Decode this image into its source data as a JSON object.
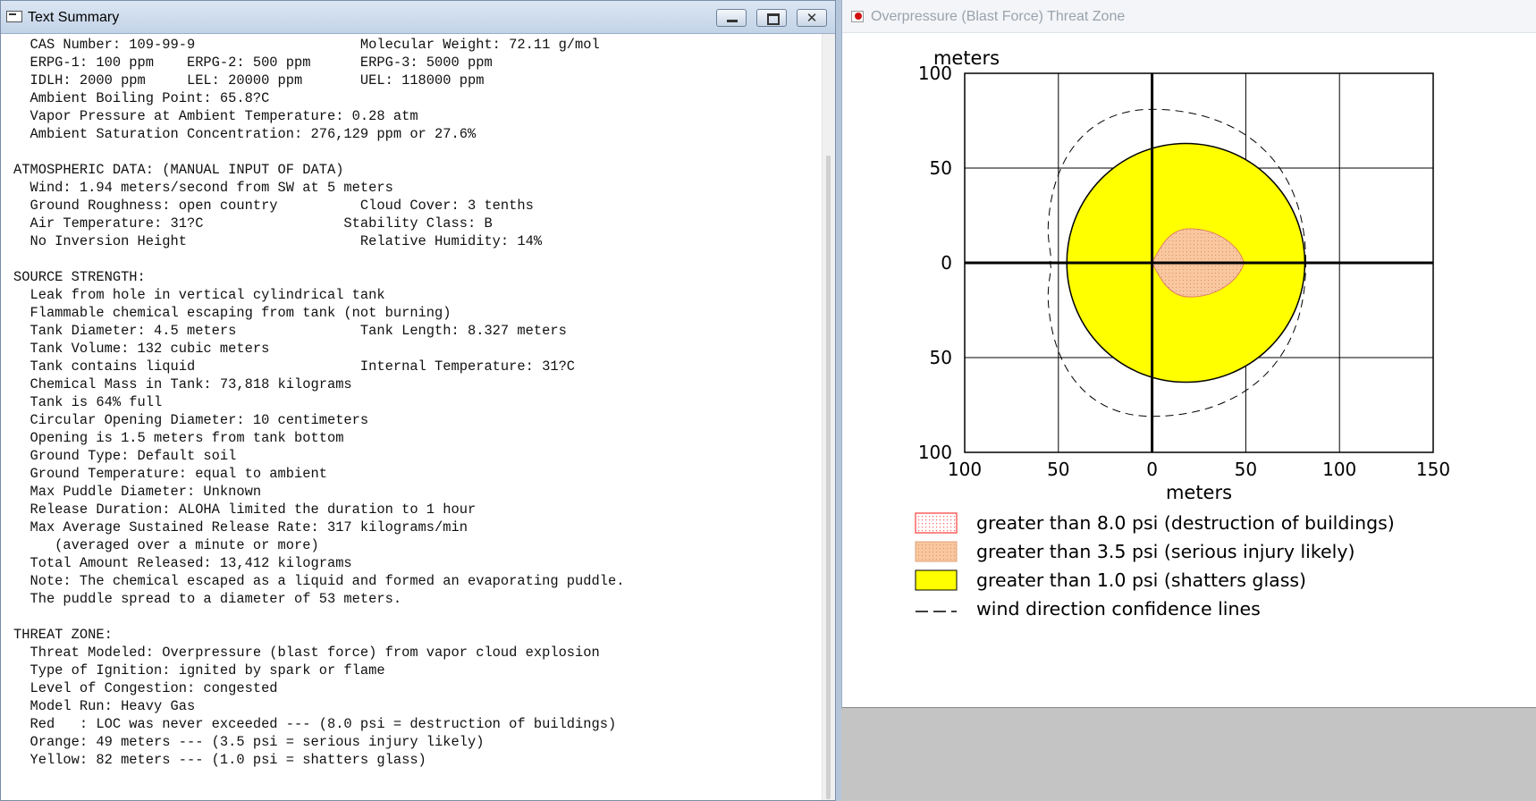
{
  "left_window": {
    "title": "Text Summary",
    "lines": [
      "  CAS Number: 109-99-9                    Molecular Weight: 72.11 g/mol",
      "  ERPG-1: 100 ppm    ERPG-2: 500 ppm      ERPG-3: 5000 ppm",
      "  IDLH: 2000 ppm     LEL: 20000 ppm       UEL: 118000 ppm",
      "  Ambient Boiling Point: 65.8?C",
      "  Vapor Pressure at Ambient Temperature: 0.28 atm",
      "  Ambient Saturation Concentration: 276,129 ppm or 27.6%",
      "",
      "ATMOSPHERIC DATA: (MANUAL INPUT OF DATA)",
      "  Wind: 1.94 meters/second from SW at 5 meters",
      "  Ground Roughness: open country          Cloud Cover: 3 tenths",
      "  Air Temperature: 31?C                 Stability Class: B",
      "  No Inversion Height                     Relative Humidity: 14%",
      "",
      "SOURCE STRENGTH:",
      "  Leak from hole in vertical cylindrical tank",
      "  Flammable chemical escaping from tank (not burning)",
      "  Tank Diameter: 4.5 meters               Tank Length: 8.327 meters",
      "  Tank Volume: 132 cubic meters",
      "  Tank contains liquid                    Internal Temperature: 31?C",
      "  Chemical Mass in Tank: 73,818 kilograms",
      "  Tank is 64% full",
      "  Circular Opening Diameter: 10 centimeters",
      "  Opening is 1.5 meters from tank bottom",
      "  Ground Type: Default soil",
      "  Ground Temperature: equal to ambient",
      "  Max Puddle Diameter: Unknown",
      "  Release Duration: ALOHA limited the duration to 1 hour",
      "  Max Average Sustained Release Rate: 317 kilograms/min",
      "     (averaged over a minute or more)",
      "  Total Amount Released: 13,412 kilograms",
      "  Note: The chemical escaped as a liquid and formed an evaporating puddle.",
      "  The puddle spread to a diameter of 53 meters.",
      "",
      "THREAT ZONE:",
      "  Threat Modeled: Overpressure (blast force) from vapor cloud explosion",
      "  Type of Ignition: ignited by spark or flame",
      "  Level of Congestion: congested",
      "  Model Run: Heavy Gas",
      "  Red   : LOC was never exceeded --- (8.0 psi = destruction of buildings)",
      "  Orange: 49 meters --- (3.5 psi = serious injury likely)",
      "  Yellow: 82 meters --- (1.0 psi = shatters glass)"
    ]
  },
  "right_window": {
    "title": "Overpressure (Blast Force) Threat Zone"
  },
  "chart_data": {
    "type": "area",
    "ylabel_top": "meters",
    "xlabel": "meters",
    "xlim": [
      -100,
      150
    ],
    "ylim": [
      -100,
      100
    ],
    "x_ticks": [
      -100,
      -50,
      0,
      50,
      100,
      150
    ],
    "y_ticks": [
      100,
      50,
      0,
      -50,
      -100
    ],
    "x_tick_labels": [
      "100",
      "50",
      "0",
      "50",
      "100",
      "150"
    ],
    "y_tick_labels": [
      "100",
      "50",
      "0",
      "50",
      "100"
    ],
    "grid": true,
    "zones": [
      {
        "name": "greater than 8.0 psi (destruction of buildings)",
        "color": "#ff6060",
        "pattern": "dotted",
        "radius_m": 0
      },
      {
        "name": "greater than 3.5 psi (serious injury likely)",
        "color": "#f8c7a0",
        "pattern": "dotted",
        "extent_m": [
          0,
          49
        ],
        "halfwidth_m": 18
      },
      {
        "name": "greater than 1.0 psi (shatters glass)",
        "color": "#ffff00",
        "center_m": [
          18,
          0
        ],
        "radius_m": 63,
        "extent_m": [
          -45,
          82
        ]
      }
    ],
    "confidence_lines": {
      "name": "wind direction confidence lines",
      "style": "dashed",
      "extent_m": [
        -56,
        82
      ]
    },
    "legend": [
      {
        "label": "greater than 8.0 psi (destruction of buildings)",
        "swatch": "red-dotted"
      },
      {
        "label": "greater than 3.5 psi (serious injury likely)",
        "swatch": "orange"
      },
      {
        "label": "greater than 1.0 psi (shatters glass)",
        "swatch": "yellow"
      },
      {
        "label": "wind direction confidence lines",
        "swatch": "dash"
      }
    ],
    "legend_position": "bottom"
  },
  "colors": {
    "yellow": "#ffff00",
    "orange": "#f8c7a0",
    "red": "#ff6060"
  },
  "icons": [
    "window-icon",
    "minimize-icon",
    "maximize-icon",
    "close-icon",
    "threat-zone-icon"
  ]
}
